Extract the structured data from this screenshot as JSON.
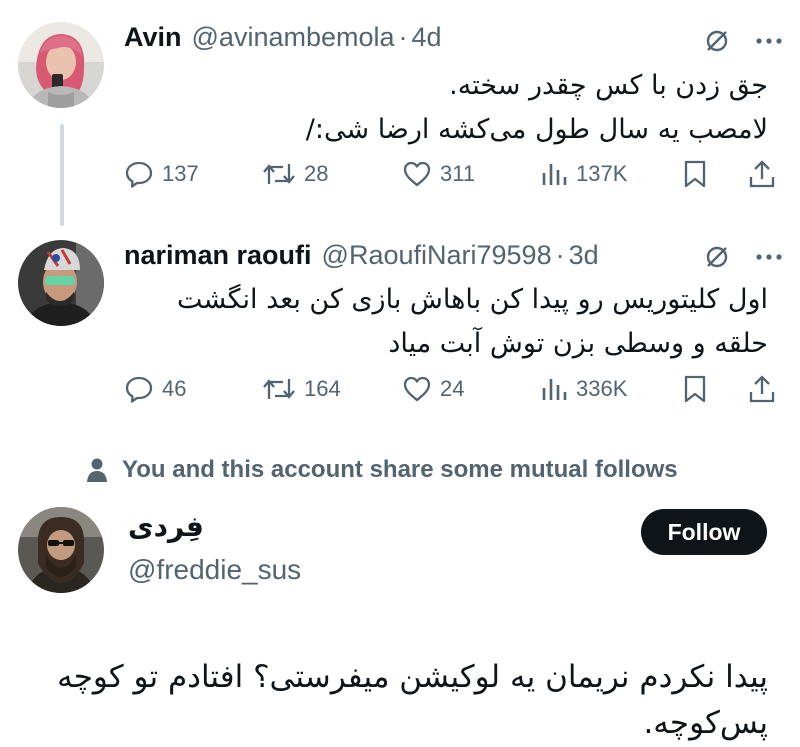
{
  "tweets": [
    {
      "name": "Avin",
      "handle": "@avinambemola",
      "separator": "·",
      "time": "4d",
      "lines": [
        "جق زدن با کس چقدر سخته.",
        "لامصب یه سال طول می‌کشه ارضا شی:/"
      ],
      "replies": "137",
      "reposts": "28",
      "likes": "311",
      "views": "137K"
    },
    {
      "name": "nariman raoufi",
      "handle": "@RaoufiNari79598",
      "separator": "·",
      "time": "3d",
      "lines": [
        "اول کلیتوریس رو پیدا کن باهاش بازی کن بعد انگشت",
        "حلقه و وسطی بزن توش آبت میاد"
      ],
      "replies": "46",
      "reposts": "164",
      "likes": "24",
      "views": "336K"
    }
  ],
  "mutual": {
    "text": "You and this account share some mutual follows"
  },
  "main_tweet": {
    "name": "فِردی",
    "handle": "@freddie_sus",
    "follow_label": "Follow",
    "lines": [
      "پیدا نکردم نریمان یه لوکیشن میفرستی؟ افتادم تو کوچه",
      "پس‌کوچه."
    ]
  },
  "colors": {
    "text": "#0f1419",
    "secondary": "#536471",
    "thread_line": "#cfd9de",
    "button": "#0f1419"
  },
  "icons": [
    "grok-icon",
    "more-icon",
    "reply-icon",
    "repost-icon",
    "like-icon",
    "views-icon",
    "bookmark-icon",
    "share-icon",
    "person-icon"
  ]
}
